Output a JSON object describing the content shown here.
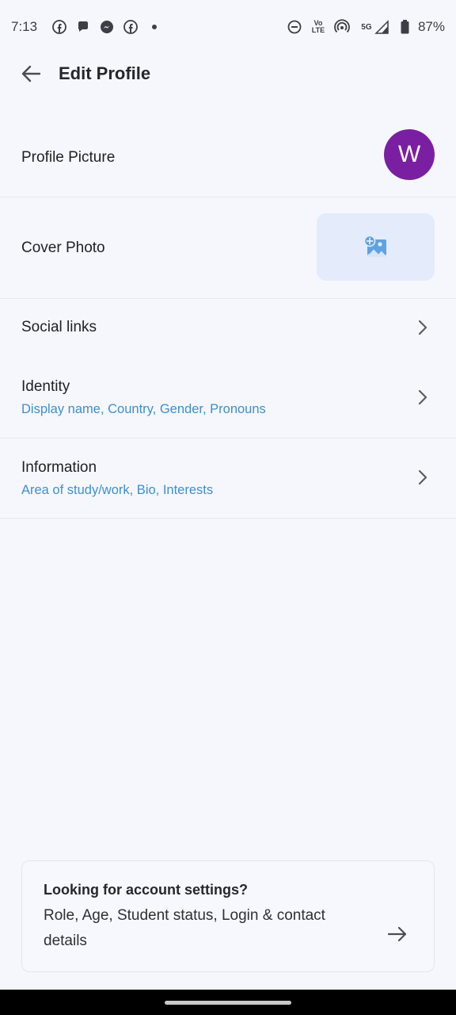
{
  "status_bar": {
    "time": "7:13",
    "notification_icons": [
      "facebook-icon",
      "chat-bubble-icon",
      "messenger-icon",
      "facebook-icon",
      "dot-icon"
    ],
    "volte_label_top": "Vo",
    "volte_label_bottom": "LTE",
    "network_label": "5G",
    "battery_percent": "87%"
  },
  "app_bar": {
    "title": "Edit Profile"
  },
  "profile_picture": {
    "label": "Profile Picture",
    "avatar_letter": "W",
    "avatar_color": "#7b1fa2"
  },
  "cover_photo": {
    "label": "Cover Photo",
    "icon": "add-photo-icon"
  },
  "menu": {
    "social_links": {
      "label": "Social links"
    },
    "identity": {
      "label": "Identity",
      "subtitle": "Display name, Country, Gender, Pronouns"
    },
    "information": {
      "label": "Information",
      "subtitle": "Area of study/work, Bio, Interests"
    }
  },
  "account_card": {
    "title": "Looking for account settings?",
    "description": "Role, Age, Student status, Login & contact details"
  },
  "colors": {
    "accent_blue": "#3d8fd1",
    "background": "#f6f7fc"
  }
}
